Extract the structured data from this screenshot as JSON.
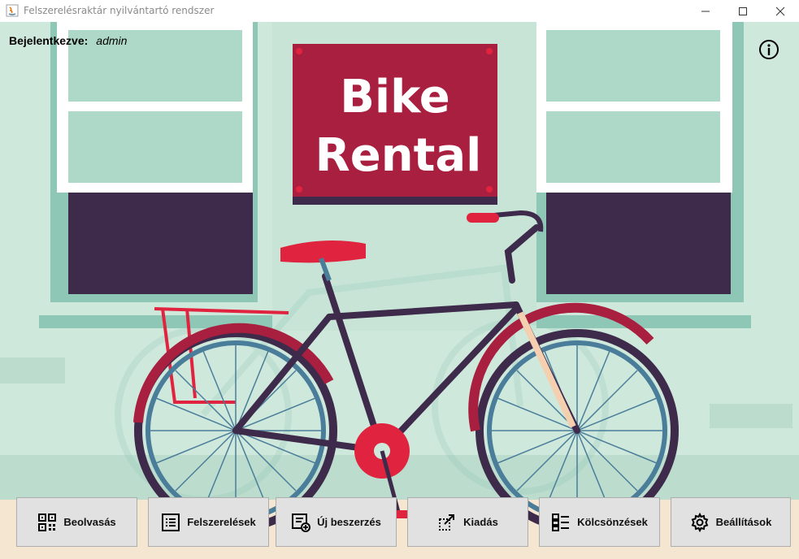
{
  "window": {
    "title": "Felszerelésraktár nyilvántartó rendszer"
  },
  "login": {
    "label": "Bejelentkezve:",
    "user": "admin"
  },
  "sign": {
    "line1": "Bike",
    "line2": "Rental"
  },
  "buttons": [
    {
      "label": "Beolvasás",
      "icon": "qr-code-icon"
    },
    {
      "label": "Felszerelések",
      "icon": "list-icon"
    },
    {
      "label": "Új beszerzés",
      "icon": "add-list-icon"
    },
    {
      "label": "Kiadás",
      "icon": "handout-icon"
    },
    {
      "label": "Kölcsönzések",
      "icon": "rentals-icon"
    },
    {
      "label": "Beállítások",
      "icon": "gear-icon"
    }
  ],
  "colors": {
    "background": "#cfe8dc",
    "sign": "#a81f3f",
    "frame": "#3f2b48",
    "wheel": "#4a7d9a",
    "accent": "#e0243f"
  }
}
